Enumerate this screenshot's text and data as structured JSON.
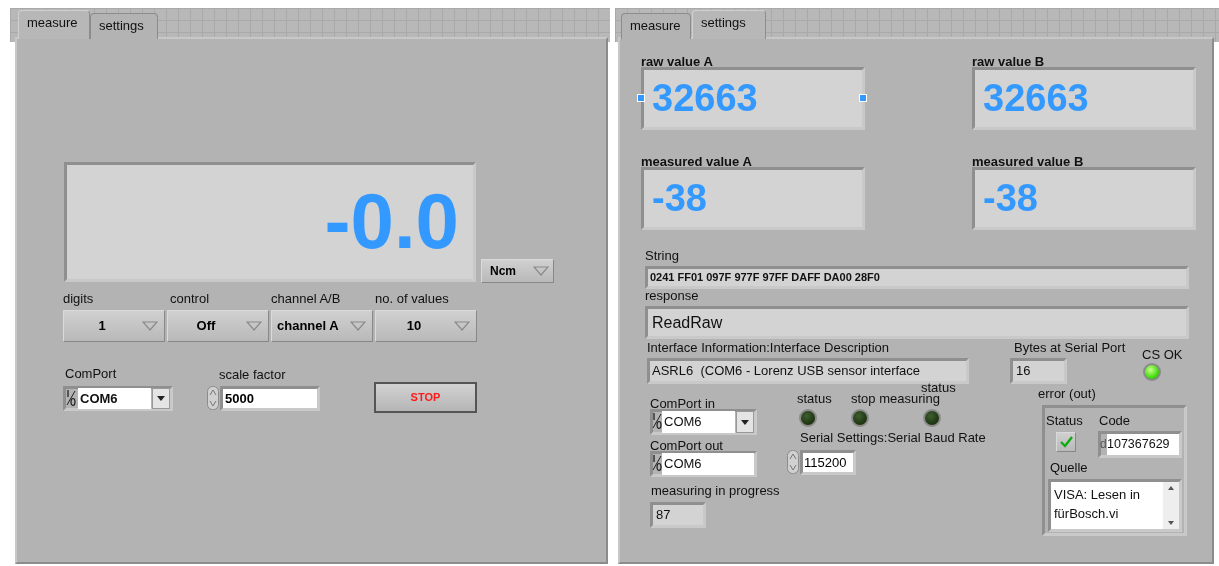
{
  "left_panel": {
    "tabs": [
      {
        "label": "measure",
        "selected": true
      },
      {
        "label": "settings",
        "selected": false
      }
    ],
    "display": {
      "value": "-0.0"
    },
    "unit": {
      "value": "Ncm"
    },
    "rings": [
      {
        "label": "digits",
        "value": "1"
      },
      {
        "label": "control",
        "value": "Off"
      },
      {
        "label": "channel A/B",
        "value": "channel A"
      },
      {
        "label": "no. of values",
        "value": "10"
      }
    ],
    "com_port": {
      "label": "ComPort",
      "value": "COM6"
    },
    "scale_factor": {
      "label": "scale factor",
      "value": "5000"
    },
    "stop_button": {
      "label": "STOP"
    }
  },
  "right_panel": {
    "tabs": [
      {
        "label": "measure",
        "selected": false
      },
      {
        "label": "settings",
        "selected": true
      }
    ],
    "raw_values": [
      {
        "label": "raw value A",
        "value": "32663"
      },
      {
        "label": "raw value B",
        "value": "32663"
      }
    ],
    "measured_values": [
      {
        "label": "measured value A",
        "value": "-38"
      },
      {
        "label": "measured value B",
        "value": "-38"
      }
    ],
    "string": {
      "label": "String",
      "value": "0241 FF01 097F 977F 97FF DAFF DA00 28F0"
    },
    "response": {
      "label": "response",
      "value": "ReadRaw"
    },
    "interface_info": {
      "label": "Interface Information:Interface Description",
      "value": "ASRL6  (COM6 - Lorenz USB sensor interface"
    },
    "bytes_at_port": {
      "label": "Bytes at Serial Port",
      "value": "16"
    },
    "cs_ok": {
      "label": "CS OK",
      "on": true
    },
    "comport_in": {
      "label": "ComPort in",
      "value": "COM6"
    },
    "comport_out": {
      "label": "ComPort out",
      "value": "COM6"
    },
    "leds": [
      {
        "label": "status",
        "on": false
      },
      {
        "label": "stop measuring",
        "on": false
      },
      {
        "label": "status",
        "on": false
      }
    ],
    "baud_rate": {
      "label": "Serial Settings:Serial Baud Rate",
      "value": "115200"
    },
    "measuring_in_progress": {
      "label": "measuring in progress",
      "value": "87"
    },
    "error_out": {
      "label": "error (out)",
      "status": {
        "label": "Status",
        "checked": true
      },
      "code": {
        "label": "Code",
        "radix": "d",
        "value": "107367629"
      },
      "source": {
        "label": "Quelle",
        "value": "VISA: Lesen in\nfürBosch.vi"
      }
    }
  }
}
